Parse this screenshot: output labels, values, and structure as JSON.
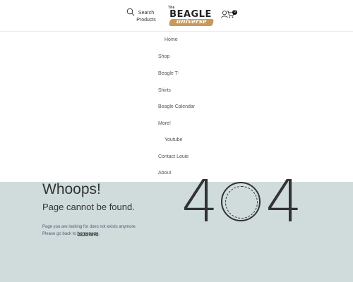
{
  "header": {
    "search_label": "Search Products",
    "logo_top": "The",
    "logo_word": "BEAGLE",
    "logo_sub": "universe",
    "cart_count": "0",
    "icons": [
      "search-icon",
      "account-icon",
      "cart-icon"
    ]
  },
  "menu": {
    "items": [
      {
        "label": "Home"
      },
      {
        "label": "Shop"
      },
      {
        "label": "Beagle T-"
      },
      {
        "label": "Shirts"
      },
      {
        "label": "Beagle Calendar"
      },
      {
        "label": "More!"
      },
      {
        "label": "Youtube"
      },
      {
        "label": "Contact Louie"
      },
      {
        "label": "About"
      }
    ]
  },
  "error": {
    "code_left": "4",
    "code_right": "4",
    "title": "Whoops!",
    "subtitle": "Page cannot be found.",
    "message_line1": "Page you are looking for does not exists anymore.",
    "message_line2_prefix": "Please go back to ",
    "message_link": "homepage",
    "message_line2_suffix": "."
  },
  "colors": {
    "background": "#cfdcdb",
    "header_bg": "#ffffff",
    "text": "#333333",
    "logo_accent": "#c89a5a"
  }
}
